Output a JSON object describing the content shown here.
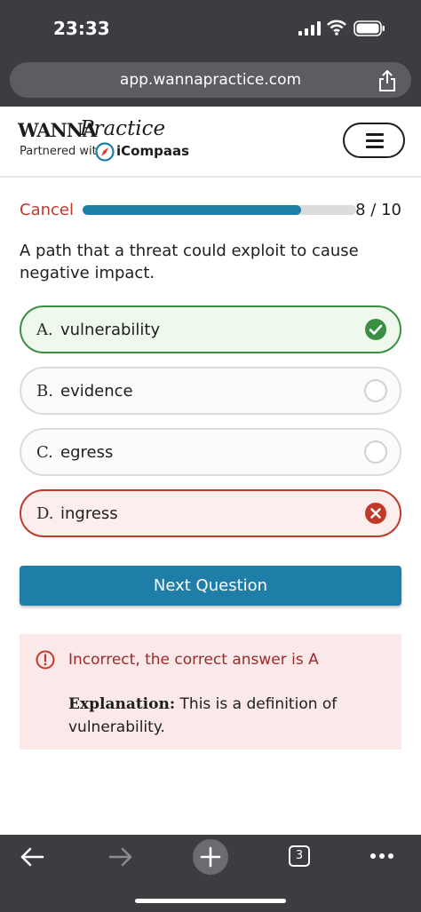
{
  "status_bar": {
    "time": "23:33"
  },
  "browser": {
    "url": "app.wannapractice.com",
    "tab_count": "3"
  },
  "header": {
    "logo_part1": "WANNA",
    "logo_part2": "Practice",
    "partnered_with": "Partnered with",
    "partner_name": "iCompaas"
  },
  "quiz": {
    "cancel_label": "Cancel",
    "progress": {
      "current": 8,
      "total": 10,
      "label": "8 / 10"
    },
    "question": "A path that a threat could exploit to cause negative impact.",
    "options": [
      {
        "letter": "A.",
        "text": "vulnerability",
        "state": "correct"
      },
      {
        "letter": "B.",
        "text": "evidence",
        "state": "neutral"
      },
      {
        "letter": "C.",
        "text": "egress",
        "state": "neutral"
      },
      {
        "letter": "D.",
        "text": "ingress",
        "state": "wrong"
      }
    ],
    "next_label": "Next Question",
    "feedback": {
      "message": "Incorrect, the correct answer is A",
      "explanation_label": "Explanation:",
      "explanation_text": " This is a definition of vulnerability."
    }
  },
  "colors": {
    "accent": "#1e7ea8",
    "correct": "#3a8f43",
    "wrong": "#c0392b",
    "chrome": "#3b3d40"
  }
}
